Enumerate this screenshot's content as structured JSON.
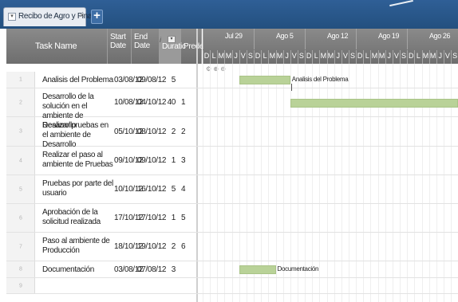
{
  "tabs": [
    {
      "label": "Recibo de Agro y Finagro",
      "close": "×"
    }
  ],
  "add_tab": "+",
  "columns": {
    "task": "Task Name",
    "start": "Start Date",
    "end": "End Date",
    "duration": "Duratic",
    "pred": "Predece"
  },
  "column_tools": {
    "info": "i",
    "filter": "▾"
  },
  "gantt": {
    "weeks": [
      "Jul 29",
      "Ago 5",
      "Ago 12",
      "Ago 19",
      "Ago 26"
    ],
    "days": [
      "D",
      "L",
      "M",
      "M",
      "J",
      "V",
      "S",
      "D",
      "L",
      "M",
      "M",
      "J",
      "V",
      "S",
      "D",
      "L",
      "M",
      "M",
      "J",
      "V",
      "S",
      "D",
      "L",
      "M",
      "M",
      "J",
      "V",
      "S",
      "D",
      "L",
      "M",
      "M",
      "J",
      "V",
      "S"
    ],
    "tools": "⚙ ⊕ ⊖"
  },
  "rows": [
    {
      "num": "1",
      "name": "Analisis del Problema",
      "start": "03/08/12",
      "end": "09/08/12",
      "duration": "5",
      "pred": "",
      "bar_label": "Analisis del Problema"
    },
    {
      "num": "2",
      "name": "Desarrollo de la solución en el ambiente de Desarrollo",
      "start": "10/08/12",
      "end": "04/10/12",
      "duration": "40",
      "pred": "1",
      "bar_label": ""
    },
    {
      "num": "3",
      "name": "Realizar pruebas en el ambiente de Desarrollo",
      "start": "05/10/12",
      "end": "08/10/12",
      "duration": "2",
      "pred": "2",
      "bar_label": ""
    },
    {
      "num": "4",
      "name": "Realizar el paso al ambiente de Pruebas",
      "start": "09/10/12",
      "end": "09/10/12",
      "duration": "1",
      "pred": "3",
      "bar_label": ""
    },
    {
      "num": "5",
      "name": "Pruebas por parte del usuario",
      "start": "10/10/12",
      "end": "16/10/12",
      "duration": "5",
      "pred": "4",
      "bar_label": ""
    },
    {
      "num": "6",
      "name": "Aprobación de la solicitud realizada",
      "start": "17/10/12",
      "end": "17/10/12",
      "duration": "1",
      "pred": "5",
      "bar_label": ""
    },
    {
      "num": "7",
      "name": "Paso al ambiente de Producción",
      "start": "18/10/12",
      "end": "19/10/12",
      "duration": "2",
      "pred": "6",
      "bar_label": ""
    },
    {
      "num": "8",
      "name": "Documentación",
      "start": "03/08/12",
      "end": "07/08/12",
      "duration": "3",
      "pred": "",
      "bar_label": "Documentación"
    },
    {
      "num": "9",
      "name": "",
      "start": "",
      "end": "",
      "duration": "",
      "pred": "",
      "bar_label": ""
    }
  ],
  "colors": {
    "bar": "#b9d298",
    "header": "#7c7c7c",
    "tabbar": "#2a5a8e"
  }
}
